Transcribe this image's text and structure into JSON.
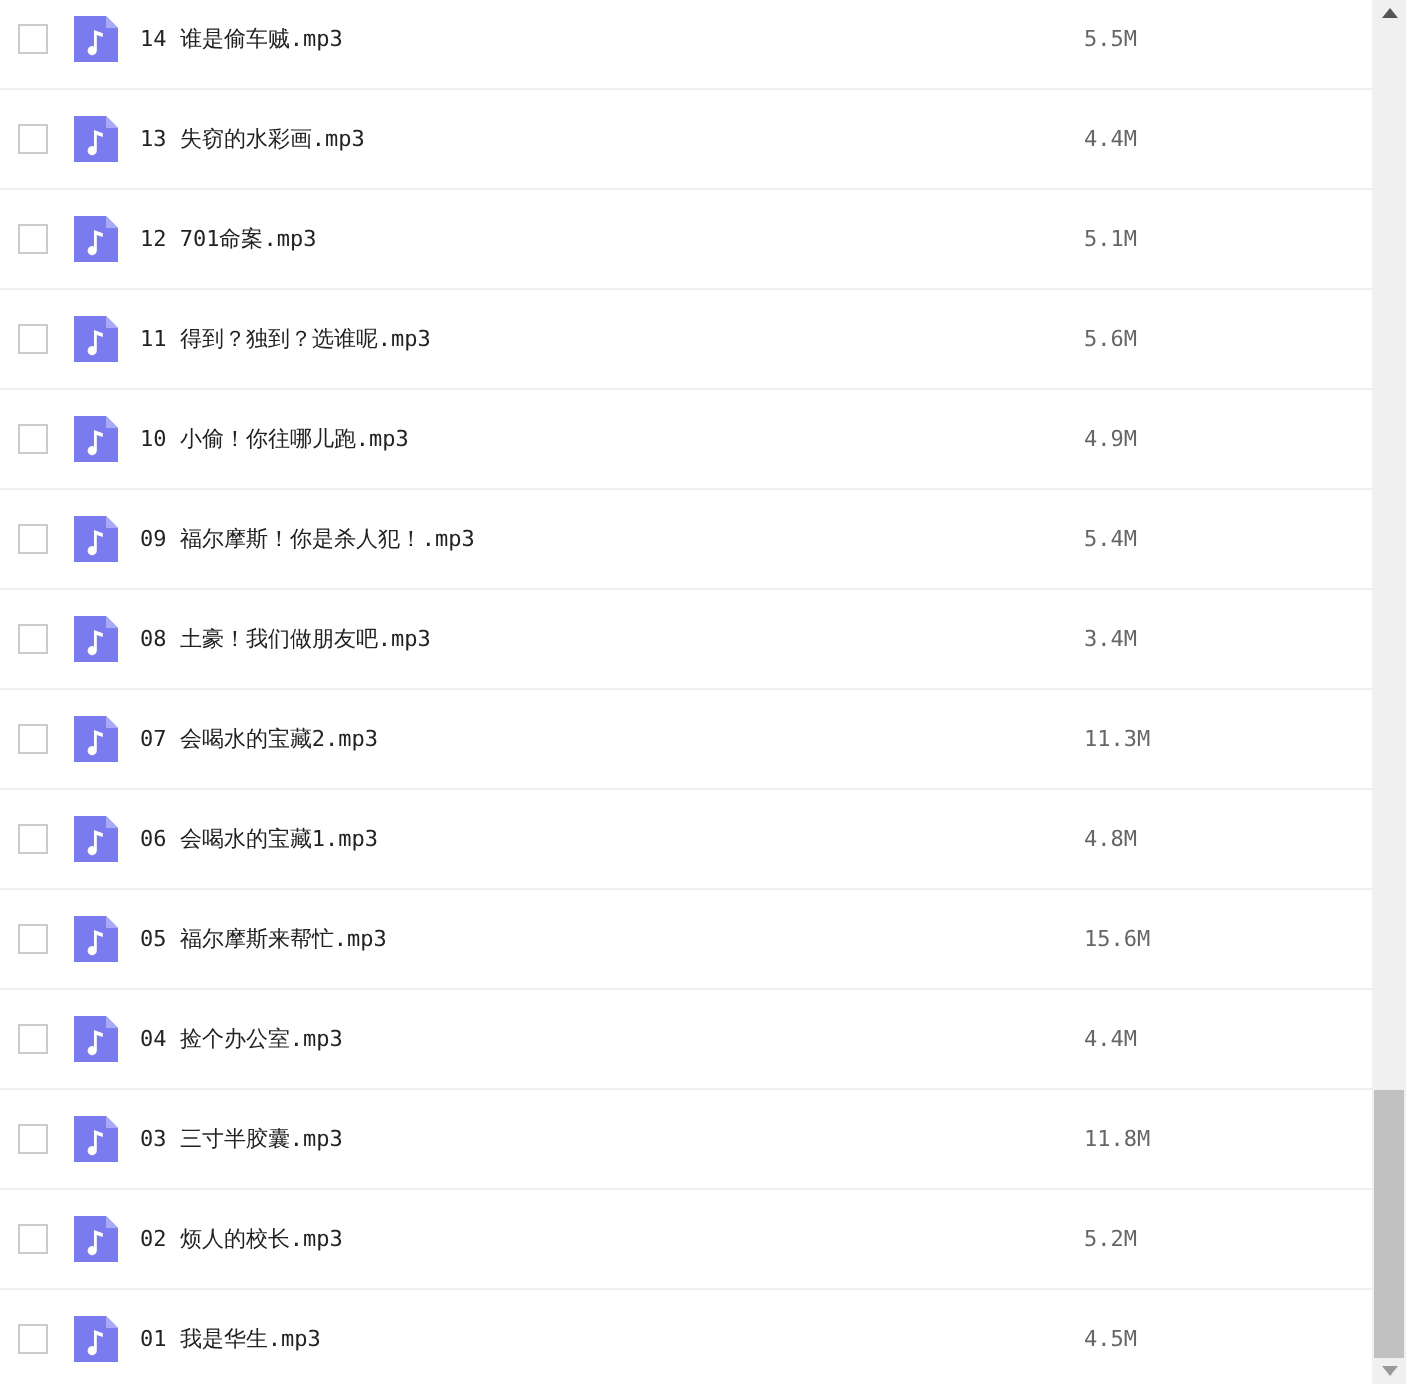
{
  "files": [
    {
      "name": "14 谁是偷车贼.mp3",
      "size": "5.5M",
      "checked": false
    },
    {
      "name": "13 失窃的水彩画.mp3",
      "size": "4.4M",
      "checked": false
    },
    {
      "name": "12 701命案.mp3",
      "size": "5.1M",
      "checked": false
    },
    {
      "name": "11 得到？独到？选谁呢.mp3",
      "size": "5.6M",
      "checked": false
    },
    {
      "name": "10 小偷！你往哪儿跑.mp3",
      "size": "4.9M",
      "checked": false
    },
    {
      "name": "09 福尔摩斯！你是杀人犯！.mp3",
      "size": "5.4M",
      "checked": false
    },
    {
      "name": "08 土豪！我们做朋友吧.mp3",
      "size": "3.4M",
      "checked": false
    },
    {
      "name": "07 会喝水的宝藏2.mp3",
      "size": "11.3M",
      "checked": false
    },
    {
      "name": "06 会喝水的宝藏1.mp3",
      "size": "4.8M",
      "checked": false
    },
    {
      "name": "05 福尔摩斯来帮忙.mp3",
      "size": "15.6M",
      "checked": false
    },
    {
      "name": "04 捡个办公室.mp3",
      "size": "4.4M",
      "checked": false
    },
    {
      "name": "03 三寸半胶囊.mp3",
      "size": "11.8M",
      "checked": false
    },
    {
      "name": "02 烦人的校长.mp3",
      "size": "5.2M",
      "checked": false
    },
    {
      "name": "01 我是华生.mp3",
      "size": "4.5M",
      "checked": false
    }
  ]
}
